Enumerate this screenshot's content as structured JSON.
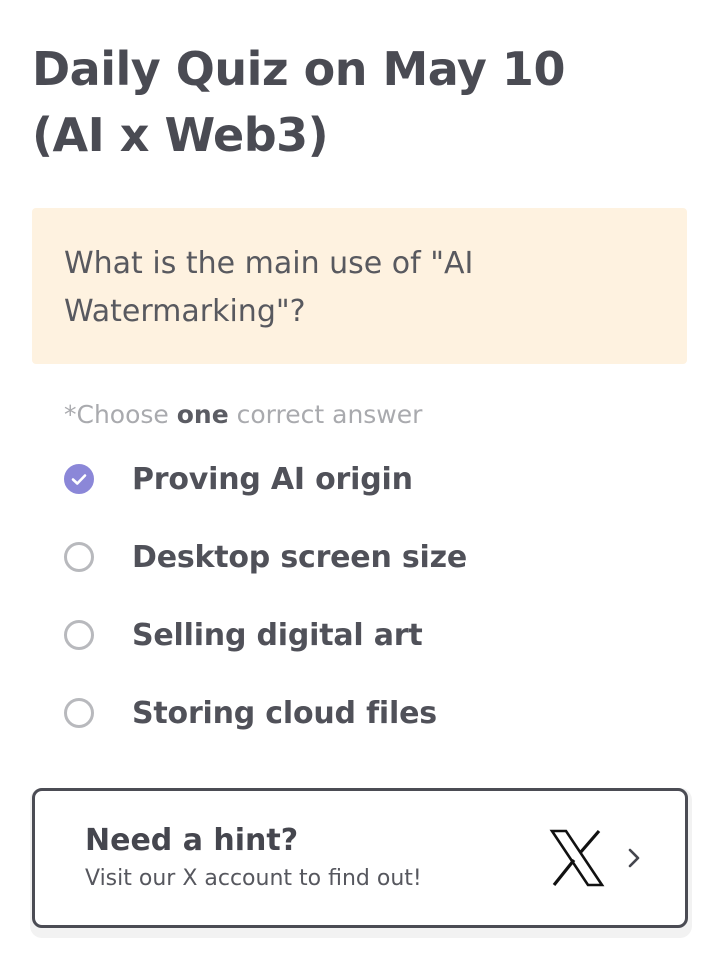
{
  "quiz": {
    "title": "Daily Quiz on May 10 (AI x Web3)",
    "question": "What is the main use of \"AI Watermarking\"?",
    "instructions": {
      "prefix": "*Choose ",
      "emphasis": "one",
      "suffix": " correct answer"
    },
    "options": [
      {
        "label": "Proving AI origin",
        "selected": true
      },
      {
        "label": "Desktop screen size",
        "selected": false
      },
      {
        "label": "Selling digital art",
        "selected": false
      },
      {
        "label": "Storing cloud files",
        "selected": false
      }
    ]
  },
  "hint": {
    "title": "Need a hint?",
    "subtitle": "Visit our X account to find out!",
    "logo_icon": "x-logo-icon",
    "arrow_icon": "chevron-right-icon"
  },
  "colors": {
    "accent": "#8b87d8",
    "question_bg": "#fef2e0",
    "text": "#4a4b53"
  }
}
